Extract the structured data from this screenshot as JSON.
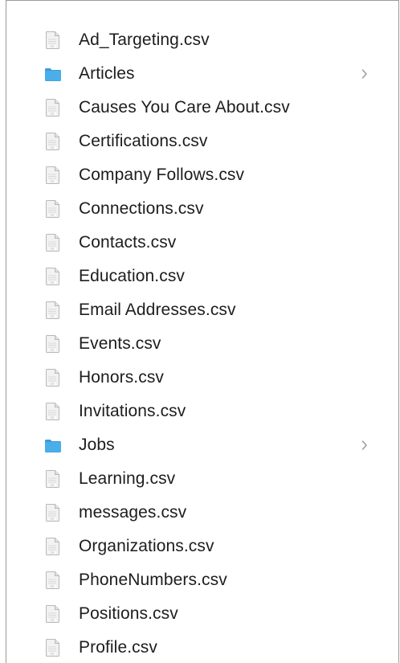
{
  "colors": {
    "folder_blue": "#4aaeea",
    "folder_blue_dark": "#3a9bd9",
    "file_fill": "#f2f2f2",
    "file_stroke": "#b8b8b8",
    "chevron": "#9a9a9a",
    "text": "#1d1d1f"
  },
  "file_list": {
    "items": [
      {
        "label": "Ad_Targeting.csv",
        "kind": "file",
        "icon": "csv-file-icon"
      },
      {
        "label": "Articles",
        "kind": "folder",
        "icon": "folder-icon"
      },
      {
        "label": "Causes You Care About.csv",
        "kind": "file",
        "icon": "csv-file-icon"
      },
      {
        "label": "Certifications.csv",
        "kind": "file",
        "icon": "csv-file-icon"
      },
      {
        "label": "Company Follows.csv",
        "kind": "file",
        "icon": "csv-file-icon"
      },
      {
        "label": "Connections.csv",
        "kind": "file",
        "icon": "csv-file-icon"
      },
      {
        "label": "Contacts.csv",
        "kind": "file",
        "icon": "csv-file-icon"
      },
      {
        "label": "Education.csv",
        "kind": "file",
        "icon": "csv-file-icon"
      },
      {
        "label": "Email Addresses.csv",
        "kind": "file",
        "icon": "csv-file-icon"
      },
      {
        "label": "Events.csv",
        "kind": "file",
        "icon": "csv-file-icon"
      },
      {
        "label": "Honors.csv",
        "kind": "file",
        "icon": "csv-file-icon"
      },
      {
        "label": "Invitations.csv",
        "kind": "file",
        "icon": "csv-file-icon"
      },
      {
        "label": "Jobs",
        "kind": "folder",
        "icon": "folder-icon"
      },
      {
        "label": "Learning.csv",
        "kind": "file",
        "icon": "csv-file-icon"
      },
      {
        "label": "messages.csv",
        "kind": "file",
        "icon": "csv-file-icon"
      },
      {
        "label": "Organizations.csv",
        "kind": "file",
        "icon": "csv-file-icon"
      },
      {
        "label": "PhoneNumbers.csv",
        "kind": "file",
        "icon": "csv-file-icon"
      },
      {
        "label": "Positions.csv",
        "kind": "file",
        "icon": "csv-file-icon"
      },
      {
        "label": "Profile.csv",
        "kind": "file",
        "icon": "csv-file-icon"
      }
    ]
  }
}
